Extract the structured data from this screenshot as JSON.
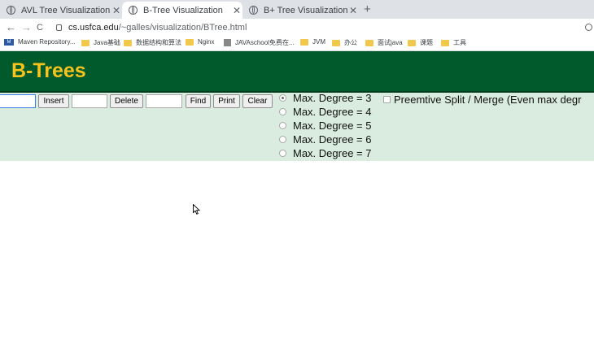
{
  "tabs": [
    {
      "title": "AVL Tree Visualization",
      "active": false
    },
    {
      "title": "B-Tree Visualization",
      "active": true
    },
    {
      "title": "B+ Tree Visualization",
      "active": false
    }
  ],
  "toolbar": {
    "back": "←",
    "forward": "→",
    "reload": "C",
    "url_host": "cs.usfca.edu",
    "url_path": "/~galles/visualization/BTree.html"
  },
  "bookmarks": [
    {
      "label": "Maven Repository...",
      "icon": "maven-icon"
    },
    {
      "label": "Java基础",
      "icon": "folder-icon"
    },
    {
      "label": "数据结构和算法",
      "icon": "folder-icon"
    },
    {
      "label": "Nginx",
      "icon": "folder-icon"
    },
    {
      "label": "JAVAschool免费在...",
      "icon": "site-icon"
    },
    {
      "label": "JVM",
      "icon": "folder-icon"
    },
    {
      "label": "办公",
      "icon": "folder-icon"
    },
    {
      "label": "面试java",
      "icon": "folder-icon"
    },
    {
      "label": "课题",
      "icon": "folder-icon"
    },
    {
      "label": "工具",
      "icon": "folder-icon"
    }
  ],
  "header": {
    "title": "B-Trees"
  },
  "controls": {
    "insert_value": "",
    "delete_value": "",
    "find_value": "",
    "insert_label": "Insert",
    "delete_label": "Delete",
    "find_label": "Find",
    "print_label": "Print",
    "clear_label": "Clear",
    "degrees": [
      {
        "label": "Max. Degree = 3",
        "checked": true
      },
      {
        "label": "Max. Degree = 4",
        "checked": false
      },
      {
        "label": "Max. Degree = 5",
        "checked": false
      },
      {
        "label": "Max. Degree = 6",
        "checked": false
      },
      {
        "label": "Max. Degree = 7",
        "checked": false
      }
    ],
    "preemptive_label": "Preemtive Split / Merge (Even max degr",
    "preemptive_checked": false
  }
}
